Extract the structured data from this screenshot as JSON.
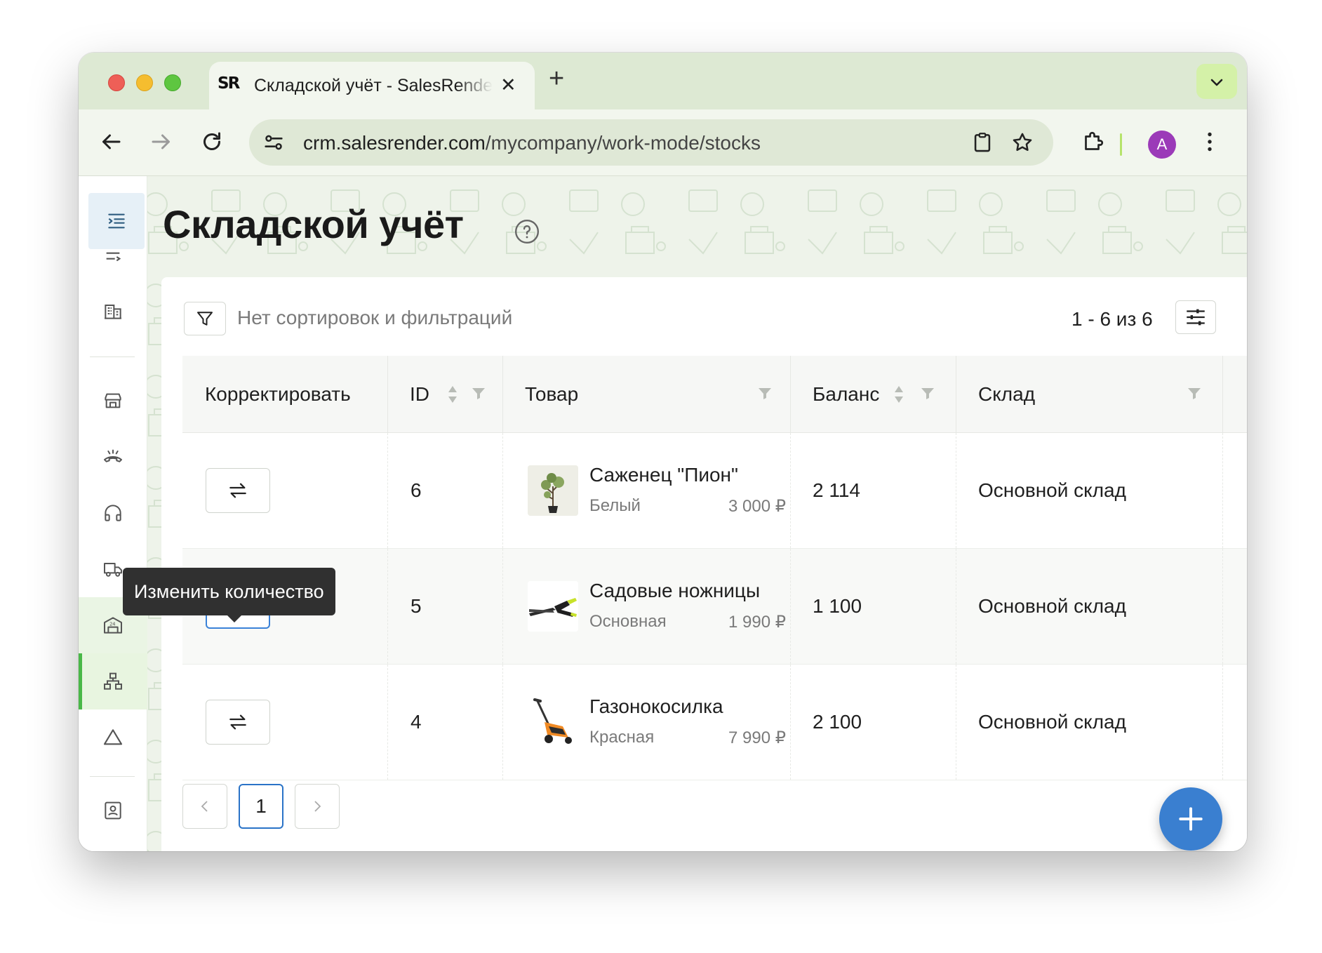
{
  "browser": {
    "tab_title": "Складской учёт - SalesRender",
    "favicon_text": "SR",
    "url_host": "crm.salesrender.com",
    "url_path": "/mycompany/work-mode/stocks",
    "profile_initial": "A"
  },
  "page": {
    "title": "Складской учёт"
  },
  "toolbar": {
    "filter_status": "Нет сортировок и фильтраций",
    "count": "1 - 6 из 6"
  },
  "table": {
    "columns": {
      "adjust": "Корректировать",
      "id": "ID",
      "product": "Товар",
      "balance": "Баланс",
      "warehouse": "Склад"
    },
    "rows": [
      {
        "id": "6",
        "name": "Саженец \"Пион\"",
        "variant": "Белый",
        "price": "3 000 ₽",
        "balance": "2 114",
        "warehouse": "Основной склад",
        "image": "plant-image"
      },
      {
        "id": "5",
        "name": "Садовые ножницы",
        "variant": "Основная",
        "price": "1 990 ₽",
        "balance": "1 100",
        "warehouse": "Основной склад",
        "image": "shears-image"
      },
      {
        "id": "4",
        "name": "Газонокосилка",
        "variant": "Красная",
        "price": "7 990 ₽",
        "balance": "2 100",
        "warehouse": "Основной склад",
        "image": "lawnmower-image"
      }
    ]
  },
  "pagination": {
    "current": "1"
  },
  "tooltip": {
    "text": "Изменить количество"
  },
  "colors": {
    "accent": "#3a7fd0",
    "sidebar_active": "#49b848",
    "tab_bar": "#dde9d3"
  }
}
